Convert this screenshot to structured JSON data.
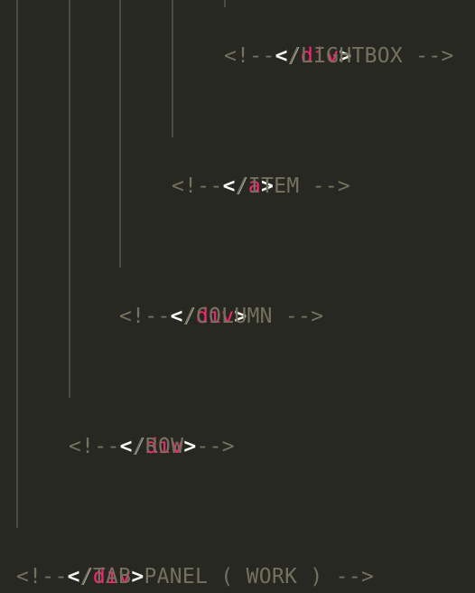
{
  "editor": {
    "theme_colors": {
      "background": "#272822",
      "text": "#f8f8f2",
      "tag": "#f92672",
      "comment": "#75715e",
      "indent_guide": "#4a4b44"
    },
    "lines": [
      {
        "open": "</",
        "tag": "div",
        "close": ">"
      },
      {
        "comment": "<!-- /LIGHTBOX -->"
      },
      {
        "open": "</",
        "tag": "a",
        "close": ">"
      },
      {
        "comment": "<!-- /ITEM -->"
      },
      {
        "open": "</",
        "tag": "div",
        "close": ">"
      },
      {
        "comment": "<!-- /COLUMN -->"
      },
      {
        "open": "</",
        "tag": "div",
        "close": ">"
      },
      {
        "comment": "<!-- /ROW -->"
      },
      {
        "open": "</",
        "tag": "div",
        "close": ">"
      },
      {
        "comment": "<!-- /TAB PANEL ( WORK ) -->"
      }
    ]
  }
}
